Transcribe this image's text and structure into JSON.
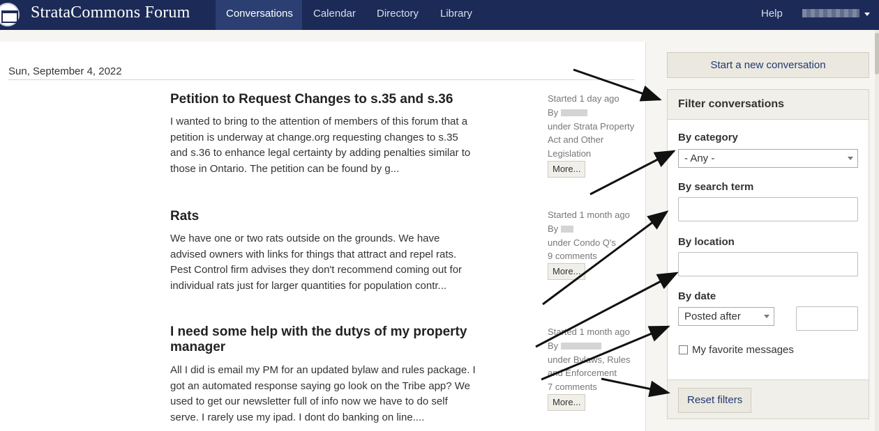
{
  "nav": {
    "brand": "StrataCommons Forum",
    "links": [
      "Conversations",
      "Calendar",
      "Directory",
      "Library"
    ],
    "help": "Help"
  },
  "main": {
    "date": "Sun, September 4, 2022",
    "conversations": [
      {
        "title": "Petition to Request Changes to s.35 and s.36",
        "body": "I wanted to bring to the attention of members of this forum that a petition is underway at change.org requesting changes to s.35 and s.36 to enhance legal certainty by adding penalties similar to those in Ontario. The petition can be found by g...",
        "started": "Started 1 day ago",
        "by": "By",
        "category": "under Strata Property Act and Other Legislation",
        "comments": "",
        "more": "More..."
      },
      {
        "title": "Rats",
        "body": "We have one or two rats outside on the grounds. We have advised owners with links for things that attract and repel rats. Pest Control firm advises they don't recommend coming out for individual rats just for larger quantities for population contr...",
        "started": "Started 1 month ago",
        "by": "By",
        "category": "under Condo Q's",
        "comments": "9 comments",
        "more": "More..."
      },
      {
        "title": "I need some help with the dutys of my property manager",
        "body": "All I did is email my PM for an updated bylaw and rules package. I got an automated response saying go look on the Tribe app? We used to get our newsletter full of info now we have to do self serve. I rarely use my ipad. I dont do banking on line....",
        "started": "Started 1 month ago",
        "by": "By",
        "category": "under Bylaws, Rules and Enforcement",
        "comments": "7 comments",
        "more": "More..."
      }
    ]
  },
  "sidebar": {
    "new_conversation": "Start a new conversation",
    "filter_title": "Filter conversations",
    "by_category": "By category",
    "category_value": "- Any -",
    "by_search_term": "By search term",
    "search_value": "",
    "by_location": "By location",
    "location_value": "",
    "by_date": "By date",
    "date_mode": "Posted after",
    "date_value": "",
    "favorites": "My favorite messages",
    "reset": "Reset filters"
  }
}
